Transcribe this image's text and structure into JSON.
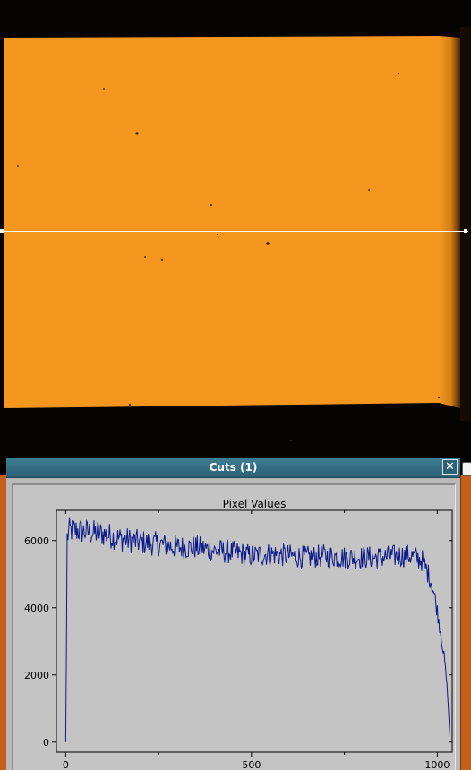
{
  "dialog": {
    "title": "Cuts (1)",
    "close_label": "✕"
  },
  "colors": {
    "image_fill": "#f5971f",
    "dialog_bg": "#b9b9b9",
    "titlebar": "#2c6074",
    "plot_bg": "#c4c4c4",
    "series": "#0b1a8a",
    "cut_line": "#ffffff",
    "background_window": "#c4601c"
  },
  "icons": {
    "close": "close-icon"
  },
  "chart_data": {
    "type": "line",
    "title": "Pixel Values",
    "xlabel": "",
    "ylabel": "",
    "xlim": [
      -25,
      1040
    ],
    "ylim": [
      -300,
      6900
    ],
    "xticks": [
      0,
      500,
      1000
    ],
    "xtick_labels": [
      "0",
      "500",
      "1000"
    ],
    "yticks": [
      0,
      2000,
      4000,
      6000
    ],
    "ytick_labels": [
      "0",
      "2000",
      "4000",
      "6000"
    ],
    "grid": false,
    "series": [
      {
        "name": "",
        "color": "#0b1a8a",
        "noise": 380,
        "points": [
          [
            0,
            0
          ],
          [
            2,
            2800
          ],
          [
            4,
            6100
          ],
          [
            10,
            6300
          ],
          [
            30,
            6300
          ],
          [
            60,
            6250
          ],
          [
            100,
            6200
          ],
          [
            150,
            6050
          ],
          [
            200,
            5950
          ],
          [
            250,
            5900
          ],
          [
            300,
            5800
          ],
          [
            350,
            5800
          ],
          [
            400,
            5700
          ],
          [
            450,
            5650
          ],
          [
            500,
            5550
          ],
          [
            550,
            5600
          ],
          [
            600,
            5550
          ],
          [
            650,
            5500
          ],
          [
            700,
            5550
          ],
          [
            750,
            5500
          ],
          [
            800,
            5500
          ],
          [
            850,
            5500
          ],
          [
            900,
            5550
          ],
          [
            930,
            5550
          ],
          [
            960,
            5400
          ],
          [
            980,
            4900
          ],
          [
            990,
            4500
          ],
          [
            1000,
            3900
          ],
          [
            1010,
            3200
          ],
          [
            1020,
            2400
          ],
          [
            1028,
            1400
          ],
          [
            1033,
            300
          ],
          [
            1035,
            0
          ]
        ]
      }
    ]
  }
}
